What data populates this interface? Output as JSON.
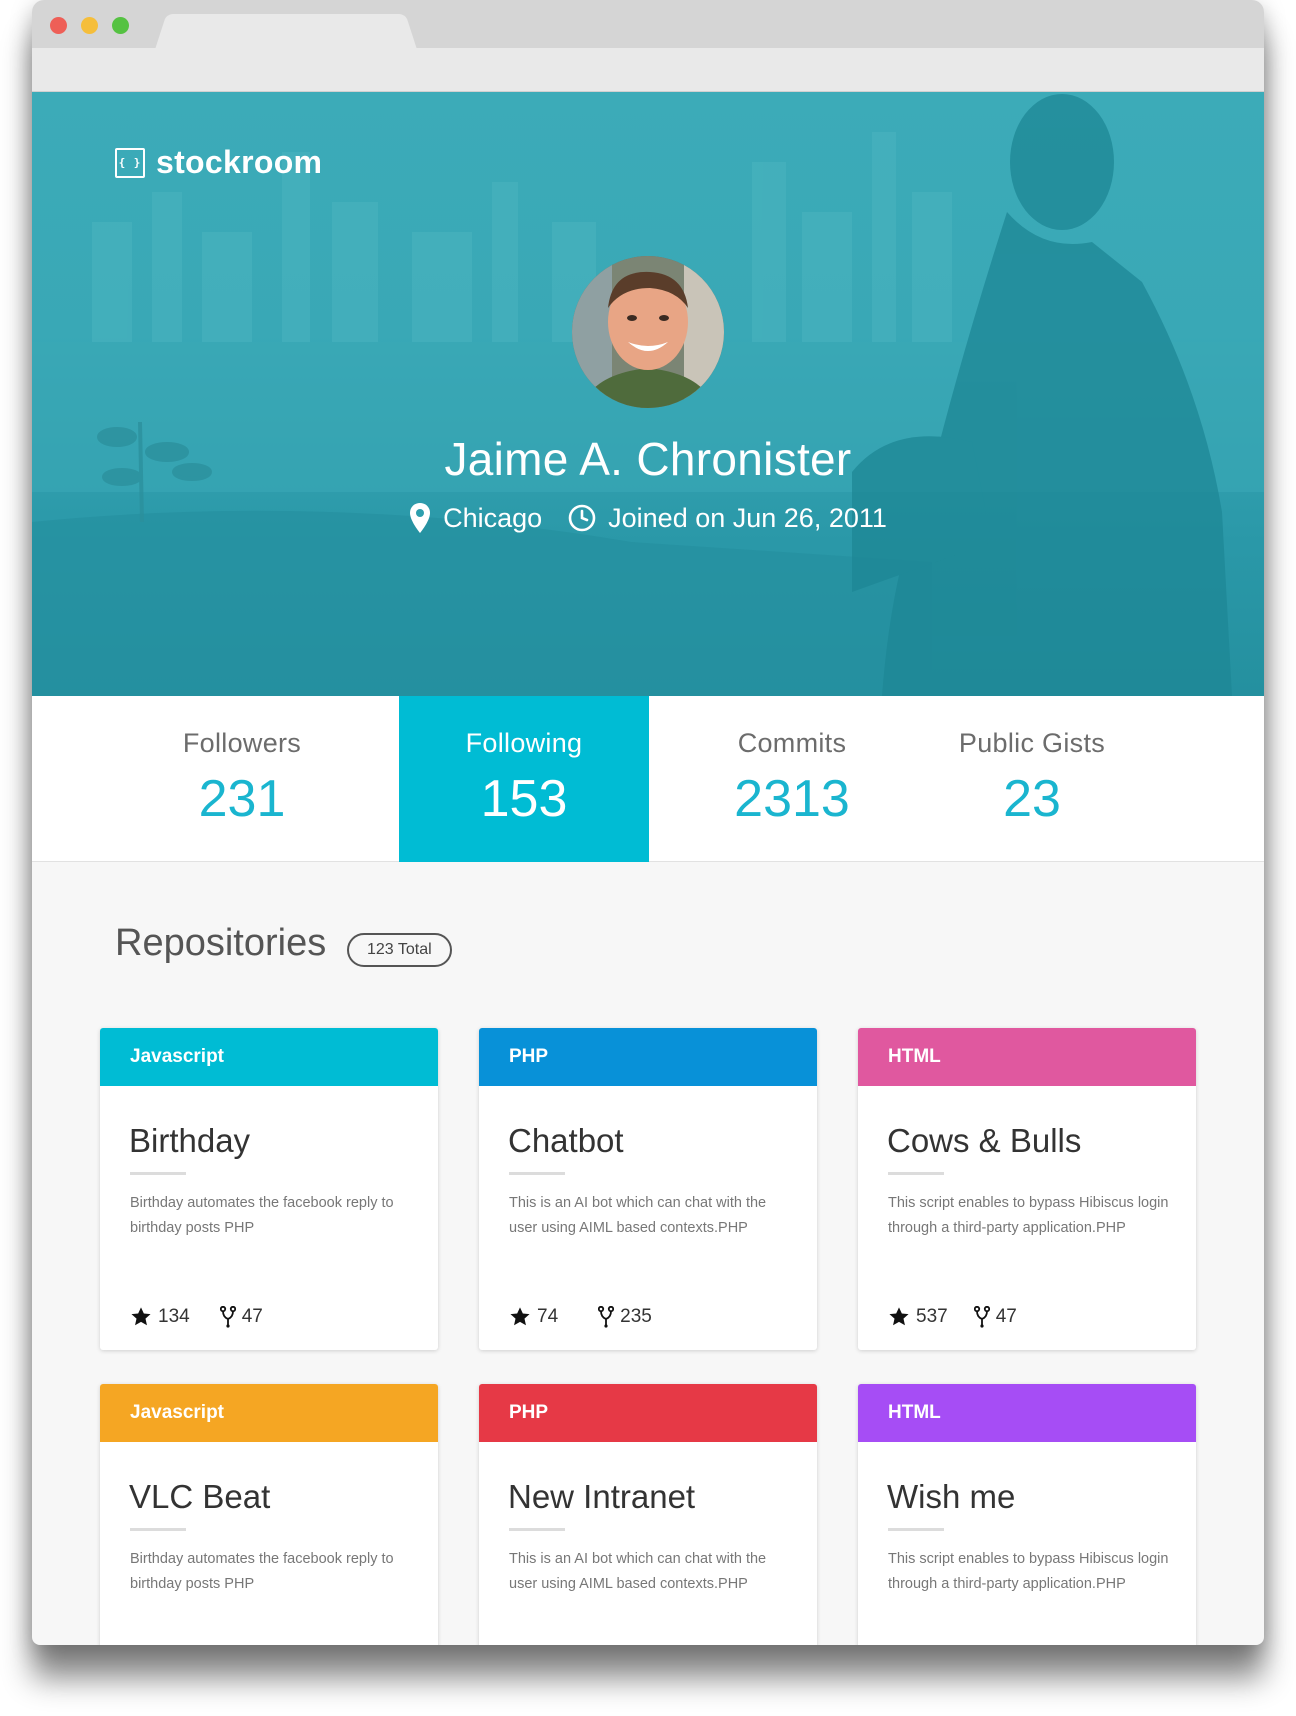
{
  "brand": {
    "name": "stockroom",
    "icon": "{ }"
  },
  "profile": {
    "name": "Jaime A. Chronister",
    "location": "Chicago",
    "joined": "Joined on Jun 26, 2011"
  },
  "stats": [
    {
      "label": "Followers",
      "value": "231",
      "active": false
    },
    {
      "label": "Following",
      "value": "153",
      "active": true
    },
    {
      "label": "Commits",
      "value": "2313",
      "active": false
    },
    {
      "label": "Public Gists",
      "value": "23",
      "active": false
    }
  ],
  "repositories": {
    "title": "Repositories",
    "total": "123 Total",
    "items": [
      {
        "language": "Javascript",
        "color": "#00bcd4",
        "name": "Birthday",
        "description": "Birthday automates the facebook reply to birthday posts PHP",
        "stars": "134",
        "forks": "47"
      },
      {
        "language": "PHP",
        "color": "#0891d8",
        "name": "Chatbot",
        "description": "This is an AI bot which can chat with the user using AIML based contexts.PHP",
        "stars": "74",
        "forks": "235"
      },
      {
        "language": "HTML",
        "color": "#e0589f",
        "name": "Cows & Bulls",
        "description": "This script enables to bypass Hibiscus login through a third-party application.PHP",
        "stars": "537",
        "forks": "47"
      },
      {
        "language": "Javascript",
        "color": "#f5a623",
        "name": "VLC Beat",
        "description": "Birthday automates the facebook reply to birthday posts PHP"
      },
      {
        "language": "PHP",
        "color": "#e63946",
        "name": "New Intranet",
        "description": "This is an AI bot which can chat with the user using AIML based contexts.PHP"
      },
      {
        "language": "HTML",
        "color": "#a64df5",
        "name": "Wish me",
        "description": "This script enables to bypass Hibiscus login through a third-party application.PHP"
      }
    ]
  }
}
